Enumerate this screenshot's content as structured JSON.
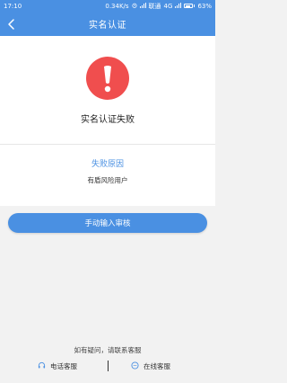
{
  "status_bar": {
    "time": "17:10",
    "net_speed": "0.34K/s",
    "carrier": "联通",
    "network": "4G",
    "battery": "63%",
    "battery_level": 0.63
  },
  "nav": {
    "title": "实名认证"
  },
  "result": {
    "status": "实名认证失败",
    "icon": "exclamation-circle-icon",
    "icon_color": "#f04e4e"
  },
  "reason": {
    "title": "失败原因",
    "text": "有盾风险用户"
  },
  "actions": {
    "manual_review": "手动输入审核"
  },
  "help": {
    "text": "如有疑问，请联系客服",
    "phone_support": "电话客服",
    "online_support": "在线客服"
  },
  "colors": {
    "accent": "#4a90e2"
  }
}
